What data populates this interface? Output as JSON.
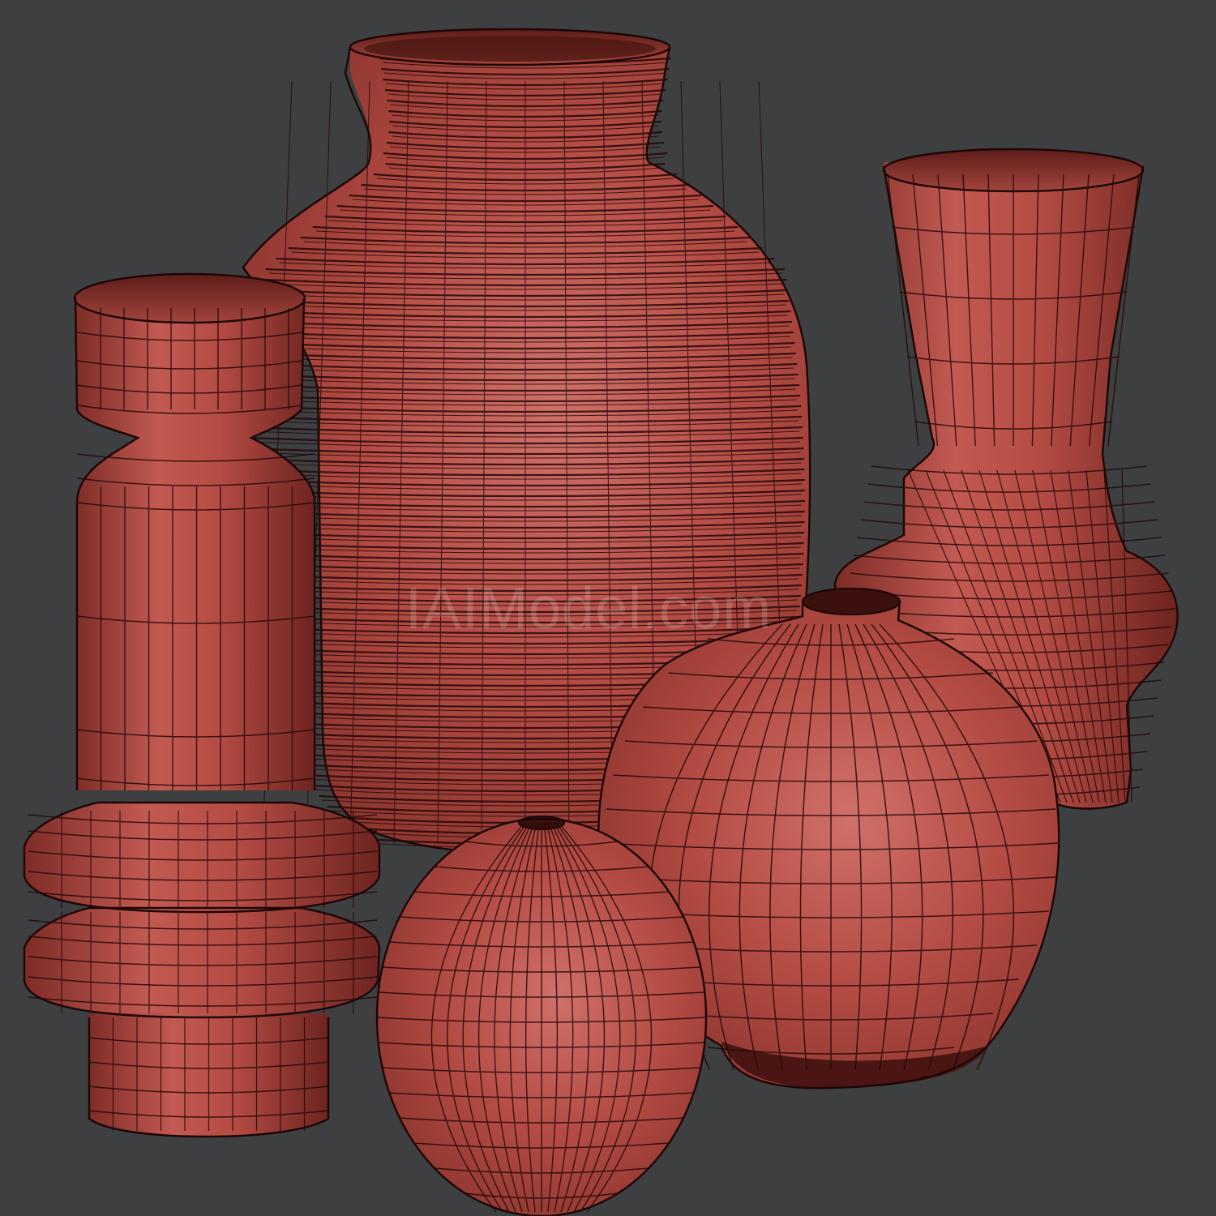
{
  "watermark": {
    "text": "IAIModel.com"
  },
  "scene": {
    "background": "#3d3f41",
    "material": "#b04a42",
    "wireframe": "#230808",
    "objects": [
      "tall-ring-vase",
      "ribbed-jar",
      "flared-vase",
      "round-vase",
      "small-sphere-vase"
    ]
  }
}
